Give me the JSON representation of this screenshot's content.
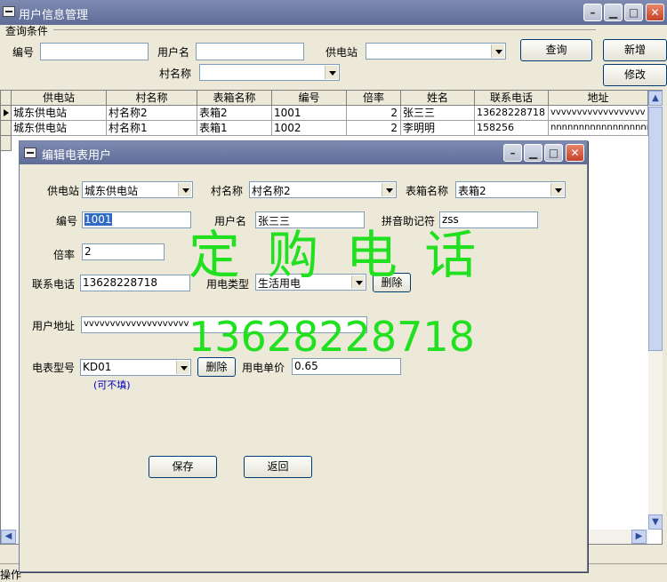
{
  "main_window": {
    "title": "用户信息管理",
    "query_group_label": "查询条件",
    "labels": {
      "id": "编号",
      "username": "用户名",
      "station": "供电站",
      "village": "村名称"
    },
    "buttons": {
      "query": "查询",
      "add": "新增",
      "modify": "修改"
    },
    "fields": {
      "id": "",
      "username": "",
      "station": "",
      "village": ""
    }
  },
  "table": {
    "columns": [
      "供电站",
      "村名称",
      "表箱名称",
      "编号",
      "倍率",
      "姓名",
      "联系电话",
      "地址"
    ],
    "rows": [
      {
        "station": "城东供电站",
        "village": "村名称2",
        "box": "表箱2",
        "id": "1001",
        "ratio": "2",
        "name": "张三三",
        "phone": "13628228718",
        "addr": "vvvvvvvvvvvvvvvvvv"
      },
      {
        "station": "城东供电站",
        "village": "村名称1",
        "box": "表箱1",
        "id": "1002",
        "ratio": "2",
        "name": "李明明",
        "phone": "158256",
        "addr": "nnnnnnnnnnnnnnnnnn"
      }
    ]
  },
  "dialog": {
    "title": "编辑电表用户",
    "labels": {
      "station": "供电站",
      "village": "村名称",
      "box_name": "表箱名称",
      "id": "编号",
      "username": "用户名",
      "pinyin": "拼音助记符",
      "ratio": "倍率",
      "phone": "联系电话",
      "elec_type": "用电类型",
      "address": "用户地址",
      "meter_model": "电表型号",
      "price": "用电单价",
      "optional_note": "(可不填)"
    },
    "values": {
      "station": "城东供电站",
      "village": "村名称2",
      "box_name": "表箱2",
      "id": "1001",
      "username": "张三三",
      "pinyin": "zss",
      "ratio": "2",
      "phone": "13628228718",
      "elec_type": "生活用电",
      "address": "vvvvvvvvvvvvvvvvvvvv",
      "meter_model": "KD01",
      "price": "0.65"
    },
    "buttons": {
      "delete_type": "删除",
      "delete_model": "删除",
      "save": "保存",
      "back": "返回"
    }
  },
  "watermark": {
    "line1": "定 购 电 话",
    "line2": "13628228718"
  },
  "statusbar": {
    "left": "操作"
  }
}
